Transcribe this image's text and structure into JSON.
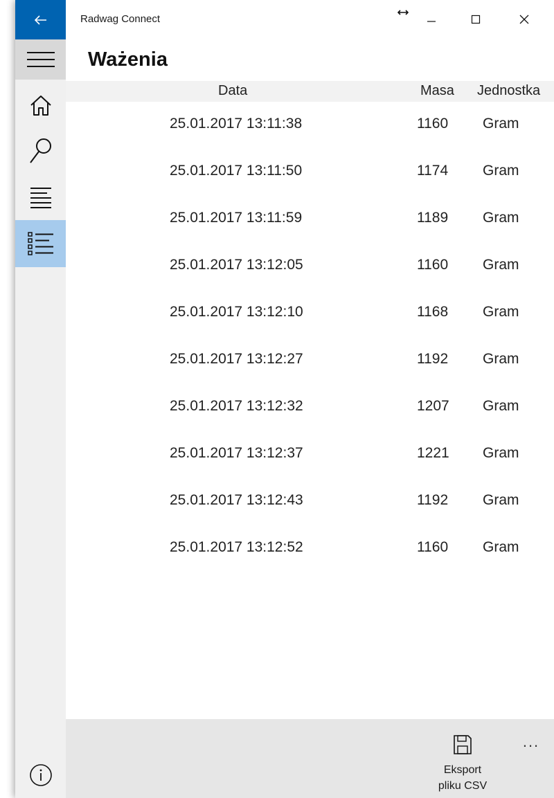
{
  "window": {
    "app_title": "Radwag Connect",
    "accent_color": "#0063b1",
    "selected_nav_color": "#a6cbed"
  },
  "nav": {
    "items": [
      {
        "icon": "hamburger-icon"
      },
      {
        "icon": "home-icon"
      },
      {
        "icon": "search-icon"
      },
      {
        "icon": "document-icon"
      },
      {
        "icon": "list-icon",
        "selected": true
      },
      {
        "icon": "info-icon"
      }
    ]
  },
  "page": {
    "title": "Ważenia"
  },
  "table": {
    "columns": [
      "Data",
      "Masa",
      "Jednostka"
    ],
    "rows": [
      {
        "date": "25.01.2017 13:11:38",
        "mass": "1160",
        "unit": "Gram"
      },
      {
        "date": "25.01.2017 13:11:50",
        "mass": "1174",
        "unit": "Gram"
      },
      {
        "date": "25.01.2017 13:11:59",
        "mass": "1189",
        "unit": "Gram"
      },
      {
        "date": "25.01.2017 13:12:05",
        "mass": "1160",
        "unit": "Gram"
      },
      {
        "date": "25.01.2017 13:12:10",
        "mass": "1168",
        "unit": "Gram"
      },
      {
        "date": "25.01.2017 13:12:27",
        "mass": "1192",
        "unit": "Gram"
      },
      {
        "date": "25.01.2017 13:12:32",
        "mass": "1207",
        "unit": "Gram"
      },
      {
        "date": "25.01.2017 13:12:37",
        "mass": "1221",
        "unit": "Gram"
      },
      {
        "date": "25.01.2017 13:12:43",
        "mass": "1192",
        "unit": "Gram"
      },
      {
        "date": "25.01.2017 13:12:52",
        "mass": "1160",
        "unit": "Gram"
      }
    ]
  },
  "commandbar": {
    "export_label_line1": "Eksport",
    "export_label_line2": "pliku CSV",
    "more_label": "..."
  }
}
